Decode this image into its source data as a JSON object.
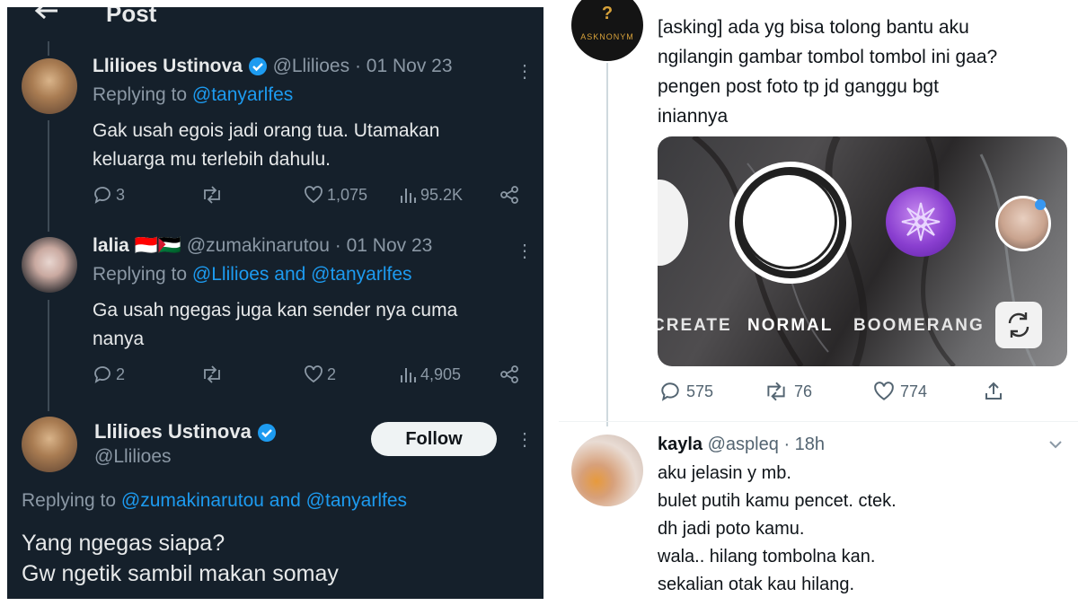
{
  "left": {
    "header": {
      "back_icon": "arrow-left-icon",
      "title": "Post"
    },
    "tweets": [
      {
        "name": "Llilioes Ustinova",
        "handle": "@Llilioes",
        "sep": "·",
        "date": "01 Nov 23",
        "replying_prefix": "Replying to ",
        "replying_to": "@tanyarlfes",
        "text_line1": "Gak usah egois jadi orang tua. Utamakan",
        "text_line2": "keluarga mu terlebih dahulu.",
        "replies": "3",
        "retweets": "",
        "likes": "1,075",
        "views": "95.2K"
      },
      {
        "name": "lalia 🇮🇩🇵🇸",
        "handle": "@zumakinarutou",
        "sep": "·",
        "date": "01 Nov 23",
        "replying_prefix": "Replying to ",
        "replying_to": "@Llilioes and @tanyarlfes",
        "text_line1": "Ga usah ngegas juga kan sender nya cuma",
        "text_line2": "nanya",
        "replies": "2",
        "retweets": "",
        "likes": "2",
        "views": "4,905"
      }
    ],
    "main": {
      "name": "Llilioes Ustinova",
      "handle": "@Llilioes",
      "follow_label": "Follow",
      "replying_prefix": "Replying to ",
      "replying_to": "@zumakinarutou and @tanyarlfes",
      "text_line1": "Yang ngegas siapa?",
      "text_line2": "Gw ngetik sambil makan somay"
    },
    "colors": {
      "bg": "#15202b",
      "accent": "#1d9bf0",
      "muted": "#8b98a5"
    }
  },
  "right": {
    "post": {
      "avatar_text": "ASKNONYM",
      "avatar_mark": "?",
      "lines": [
        "[asking] ada yg bisa tolong bantu aku",
        "ngilangin gambar tombol tombol ini gaa?",
        "pengen post foto tp jd ganggu bgt",
        "iniannya"
      ],
      "camera_modes": [
        "CREATE",
        "NORMAL",
        "BOOMERANG"
      ],
      "replies": "575",
      "retweets": "76",
      "likes": "774"
    },
    "reply": {
      "name": "kayla",
      "handle": "@aspleq",
      "sep": "·",
      "time": "18h",
      "lines": [
        "aku jelasin y mb.",
        "bulet putih kamu pencet. ctek.",
        "dh jadi poto kamu.",
        "wala.. hilang tombolna kan.",
        "sekalian otak kau hilang."
      ]
    }
  }
}
